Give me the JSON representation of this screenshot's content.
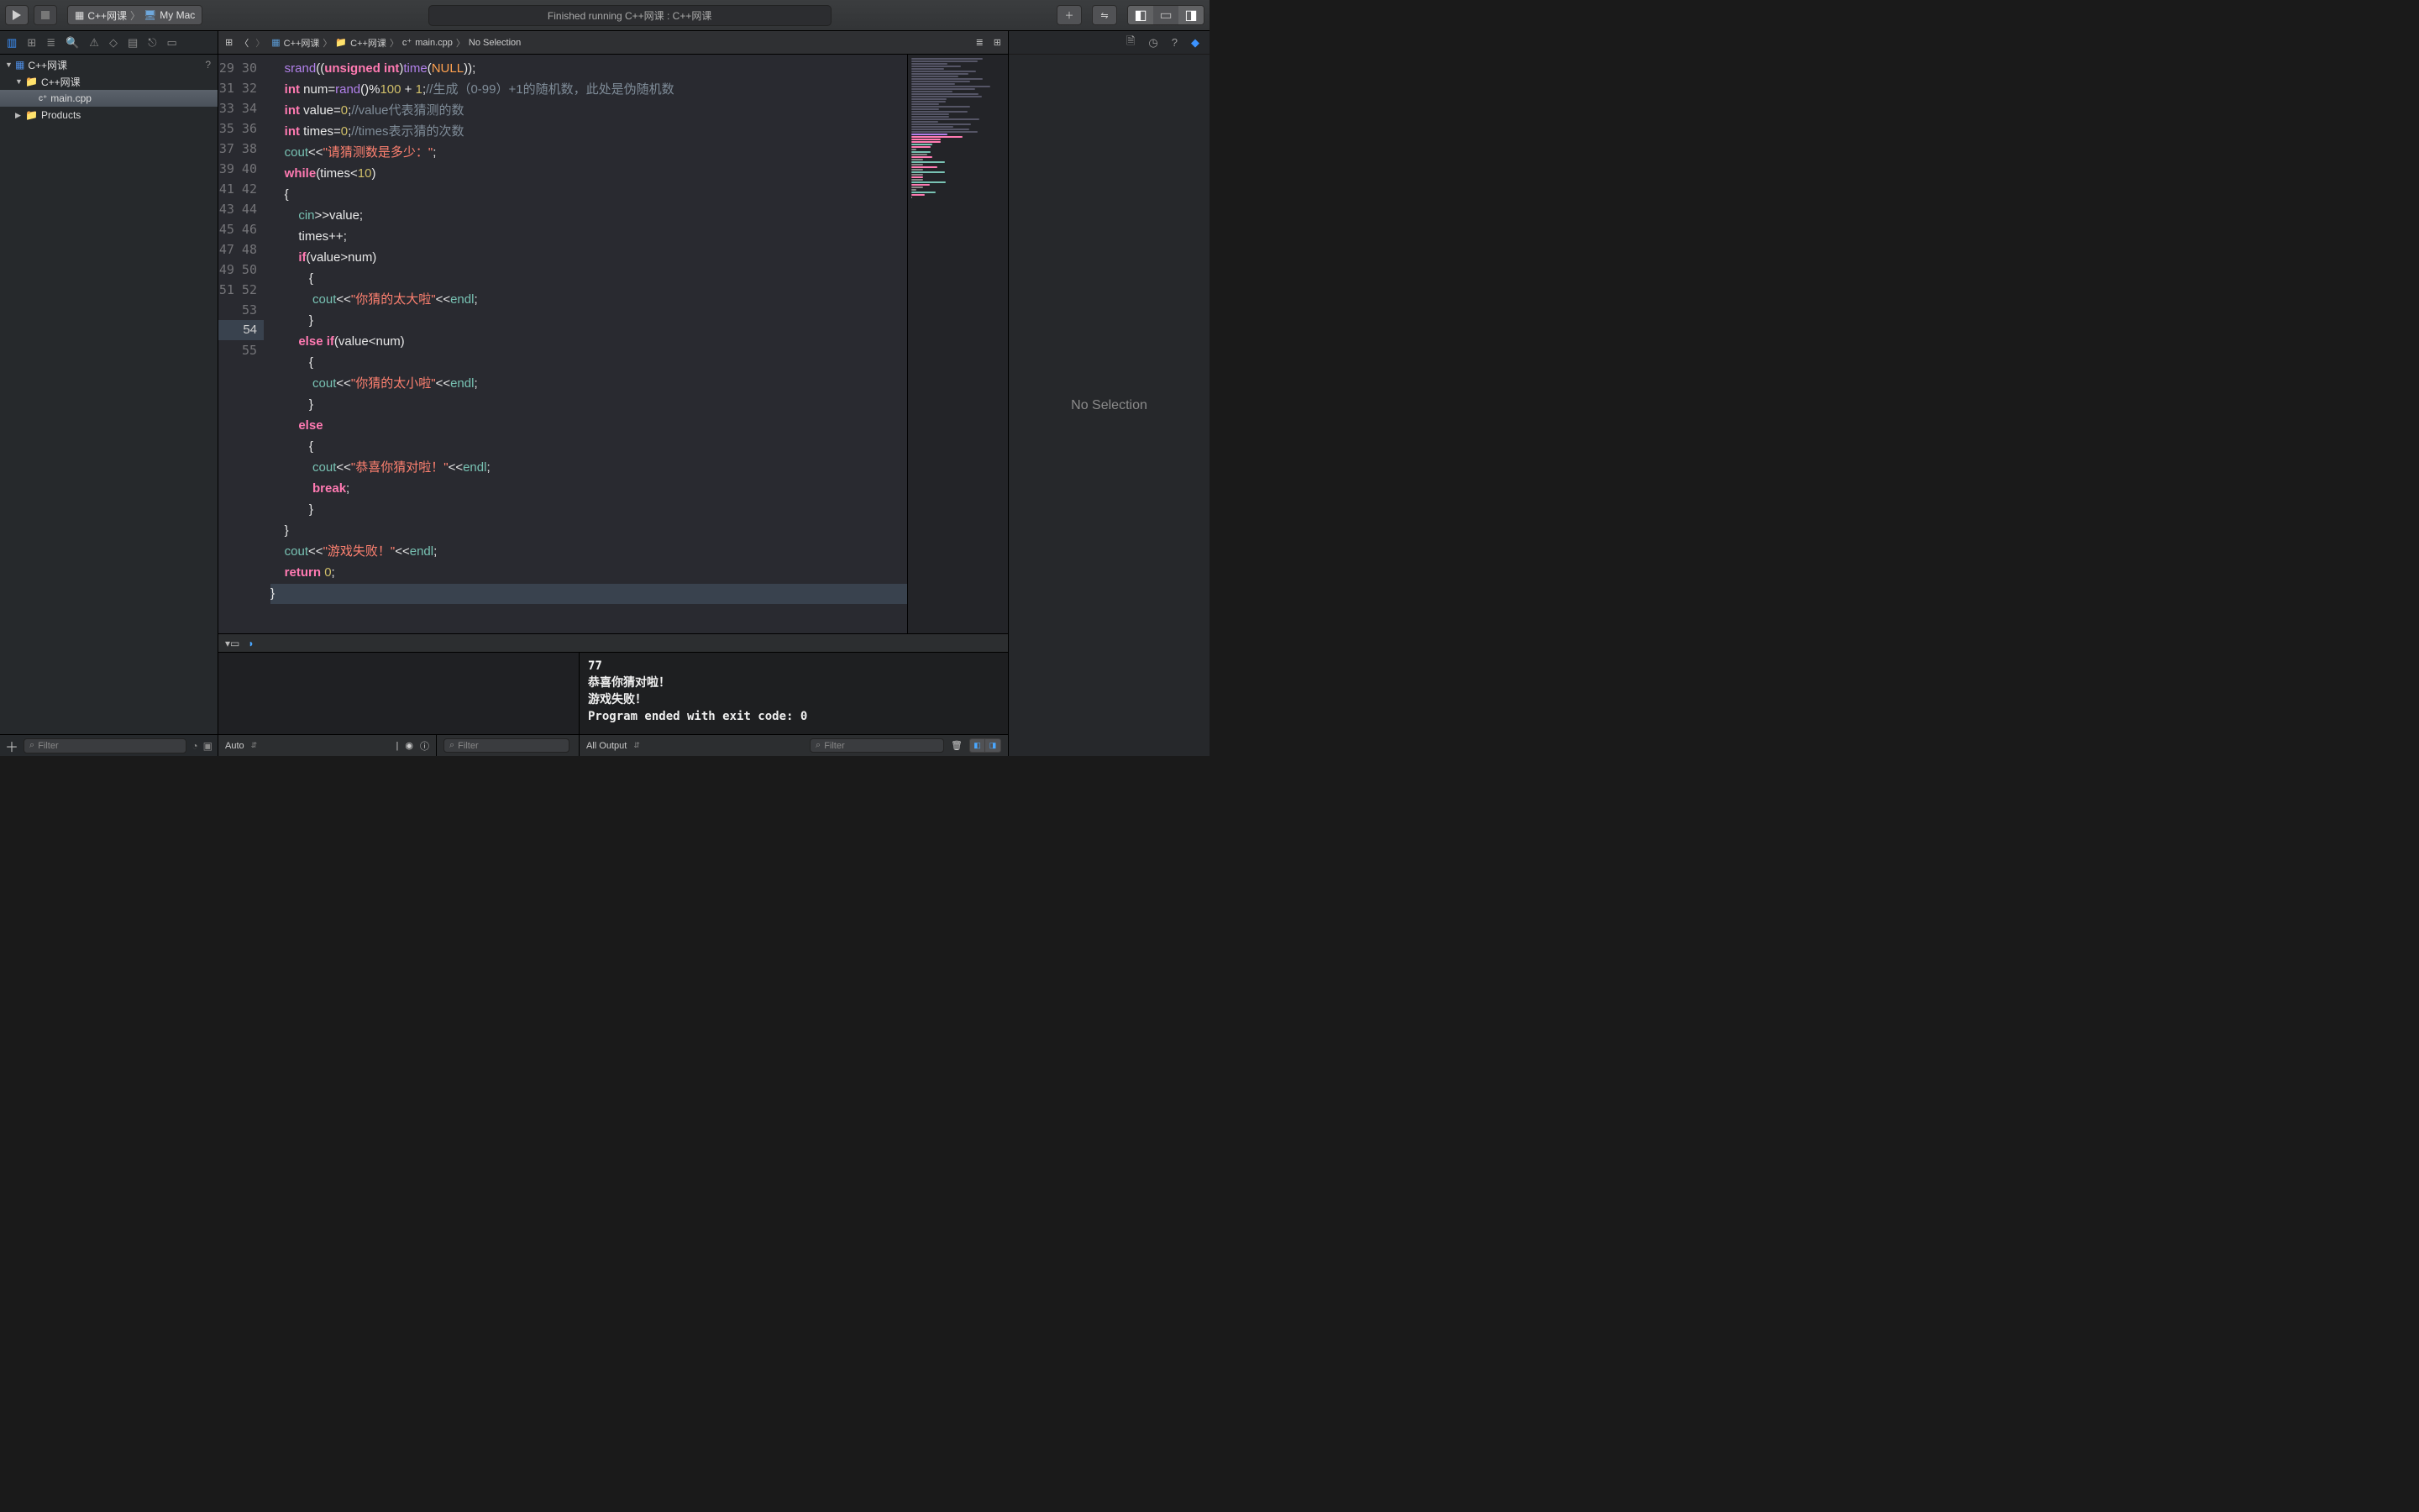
{
  "toolbar": {
    "scheme_target": "C++网课",
    "scheme_device": "My Mac",
    "status_text": "Finished running C++网课 : C++网课"
  },
  "navigator": {
    "project_name": "C++网课",
    "group_name": "C++网课",
    "file_name": "main.cpp",
    "products": "Products",
    "filter_placeholder": "Filter"
  },
  "jumpbar": {
    "proj": "C++网课",
    "group": "C++网课",
    "file": "main.cpp",
    "symbol": "No Selection"
  },
  "editor": {
    "first_line_no": 29,
    "lines": [
      [
        [
          "pl",
          "    "
        ],
        [
          "fn",
          "srand"
        ],
        [
          "op",
          "(("
        ],
        [
          "ty",
          "unsigned"
        ],
        [
          "pl",
          " "
        ],
        [
          "ty",
          "int"
        ],
        [
          "op",
          ")"
        ],
        [
          "fn",
          "time"
        ],
        [
          "op",
          "("
        ],
        [
          "mac",
          "NULL"
        ],
        [
          "op",
          "));"
        ]
      ],
      [
        [
          "pl",
          "    "
        ],
        [
          "ty",
          "int"
        ],
        [
          "pl",
          " num="
        ],
        [
          "fn",
          "rand"
        ],
        [
          "op",
          "()%"
        ],
        [
          "num",
          "100"
        ],
        [
          "pl",
          " "
        ],
        [
          "op",
          "+"
        ],
        [
          "pl",
          " "
        ],
        [
          "num",
          "1"
        ],
        [
          "op",
          ";"
        ],
        [
          "cm",
          "//生成（0-99）+1的随机数，此处是伪随机数"
        ]
      ],
      [
        [
          "pl",
          "    "
        ],
        [
          "ty",
          "int"
        ],
        [
          "pl",
          " value="
        ],
        [
          "num",
          "0"
        ],
        [
          "op",
          ";"
        ],
        [
          "cm",
          "//value代表猜测的数"
        ]
      ],
      [
        [
          "pl",
          "    "
        ],
        [
          "ty",
          "int"
        ],
        [
          "pl",
          " times="
        ],
        [
          "num",
          "0"
        ],
        [
          "op",
          ";"
        ],
        [
          "cm",
          "//times表示猜的次数"
        ]
      ],
      [
        [
          "pl",
          "    "
        ],
        [
          "id2",
          "cout"
        ],
        [
          "op",
          "<<"
        ],
        [
          "str",
          "\"请猜测数是多少：\""
        ],
        [
          "op",
          ";"
        ]
      ],
      [
        [
          "pl",
          "    "
        ],
        [
          "kw",
          "while"
        ],
        [
          "op",
          "(times<"
        ],
        [
          "num",
          "10"
        ],
        [
          "op",
          ")"
        ]
      ],
      [
        [
          "pl",
          "    {"
        ]
      ],
      [
        [
          "pl",
          "        "
        ],
        [
          "id2",
          "cin"
        ],
        [
          "op",
          ">>value;"
        ]
      ],
      [
        [
          "pl",
          "        times++;"
        ]
      ],
      [
        [
          "pl",
          "        "
        ],
        [
          "kw",
          "if"
        ],
        [
          "op",
          "(value>num)"
        ]
      ],
      [
        [
          "pl",
          "           {"
        ]
      ],
      [
        [
          "pl",
          "            "
        ],
        [
          "id2",
          "cout"
        ],
        [
          "op",
          "<<"
        ],
        [
          "str",
          "\"你猜的太大啦\""
        ],
        [
          "op",
          "<<"
        ],
        [
          "id2",
          "endl"
        ],
        [
          "op",
          ";"
        ]
      ],
      [
        [
          "pl",
          "           }"
        ]
      ],
      [
        [
          "pl",
          "        "
        ],
        [
          "kw",
          "else"
        ],
        [
          "pl",
          " "
        ],
        [
          "kw",
          "if"
        ],
        [
          "op",
          "(value<num)"
        ]
      ],
      [
        [
          "pl",
          "           {"
        ]
      ],
      [
        [
          "pl",
          "            "
        ],
        [
          "id2",
          "cout"
        ],
        [
          "op",
          "<<"
        ],
        [
          "str",
          "\"你猜的太小啦\""
        ],
        [
          "op",
          "<<"
        ],
        [
          "id2",
          "endl"
        ],
        [
          "op",
          ";"
        ]
      ],
      [
        [
          "pl",
          "           }"
        ]
      ],
      [
        [
          "pl",
          "        "
        ],
        [
          "kw",
          "else"
        ]
      ],
      [
        [
          "pl",
          "           {"
        ]
      ],
      [
        [
          "pl",
          "            "
        ],
        [
          "id2",
          "cout"
        ],
        [
          "op",
          "<<"
        ],
        [
          "str",
          "\"恭喜你猜对啦！\""
        ],
        [
          "op",
          "<<"
        ],
        [
          "id2",
          "endl"
        ],
        [
          "op",
          ";"
        ]
      ],
      [
        [
          "pl",
          "            "
        ],
        [
          "kw",
          "break"
        ],
        [
          "op",
          ";"
        ]
      ],
      [
        [
          "pl",
          "           }"
        ]
      ],
      [
        [
          "pl",
          "    }"
        ]
      ],
      [
        [
          "pl",
          "    "
        ],
        [
          "id2",
          "cout"
        ],
        [
          "op",
          "<<"
        ],
        [
          "str",
          "\"游戏失败！\""
        ],
        [
          "op",
          "<<"
        ],
        [
          "id2",
          "endl"
        ],
        [
          "op",
          ";"
        ]
      ],
      [
        [
          "pl",
          "    "
        ],
        [
          "kw",
          "return"
        ],
        [
          "pl",
          " "
        ],
        [
          "num",
          "0"
        ],
        [
          "op",
          ";"
        ]
      ],
      [
        [
          "pl",
          "}"
        ]
      ],
      [
        [
          "pl",
          ""
        ]
      ]
    ],
    "highlight_index": 25
  },
  "console": {
    "lines": [
      "77",
      "恭喜你猜对啦！",
      "游戏失败！",
      "Program ended with exit code: 0"
    ]
  },
  "bottombar": {
    "auto": "Auto",
    "filter_placeholder": "Filter",
    "all_output": "All Output",
    "filter2_placeholder": "Filter"
  },
  "inspector": {
    "empty_text": "No Selection"
  }
}
